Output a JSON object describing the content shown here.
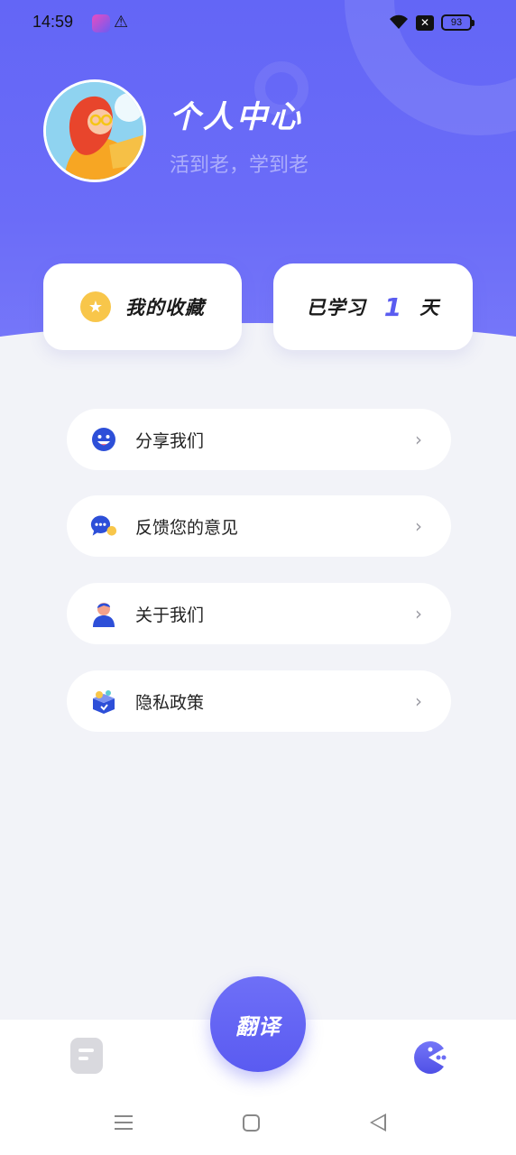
{
  "status_bar": {
    "time": "14:59",
    "battery": "93",
    "icons": [
      "app-notification-icon",
      "warning-icon",
      "wifi-icon",
      "sim-off-icon",
      "battery-icon"
    ]
  },
  "profile": {
    "title": "个人中心",
    "subtitle": "活到老，学到老"
  },
  "cards": {
    "favorites_label": "我的收藏",
    "study_prefix": "已学习",
    "study_days": "1",
    "study_suffix": "天"
  },
  "menu": {
    "items": [
      {
        "label": "分享我们",
        "icon": "smile-icon"
      },
      {
        "label": "反馈您的意见",
        "icon": "chat-bubble-icon"
      },
      {
        "label": "关于我们",
        "icon": "person-icon"
      },
      {
        "label": "隐私政策",
        "icon": "privacy-box-icon"
      }
    ]
  },
  "tabbar": {
    "center_label": "翻译",
    "tabs": [
      "document-icon",
      "profile-pacman-icon"
    ]
  },
  "colors": {
    "accent": "#6366F6",
    "star": "#F8C64A",
    "icon_blue": "#2D4FD8"
  }
}
